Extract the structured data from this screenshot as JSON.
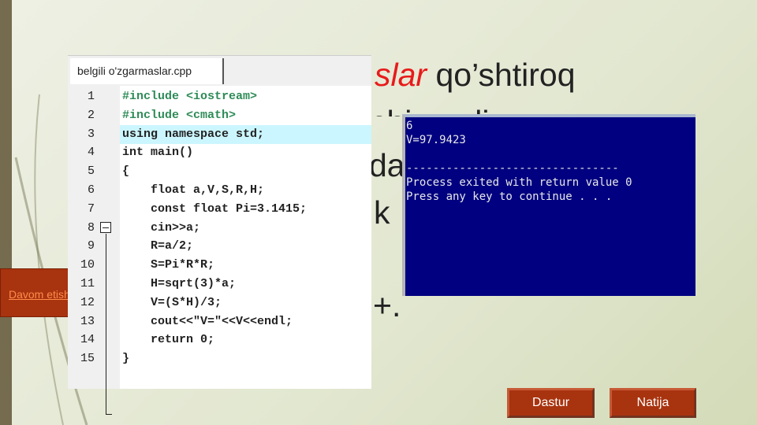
{
  "slide": {
    "fragments": [
      "slar",
      "qo’shtiroq",
      "chiga olingan",
      "da",
      "’ k",
      "+",
      "."
    ]
  },
  "editor": {
    "tab": "belgili o'zgarmaslar.cpp",
    "line_numbers": [
      "1",
      "2",
      "3",
      "4",
      "5",
      "6",
      "7",
      "8",
      "9",
      "10",
      "11",
      "12",
      "13",
      "14",
      "15"
    ],
    "lines": [
      "#include <iostream>",
      "#include <cmath>",
      "using namespace std;",
      "int main()",
      "{",
      "    float a,V,S,R,H;",
      "    const float Pi=3.1415;",
      "    cin>>a;",
      "    R=a/2;",
      "    S=Pi*R*R;",
      "    H=sqrt(3)*a;",
      "    V=(S*H)/3;",
      "    cout<<\"V=\"<<V<<endl;",
      "    return 0;",
      "}"
    ]
  },
  "console": {
    "text": "6\nV=97.9423\n\n--------------------------------\nProcess exited with return value 0\nPress any key to continue . . ."
  },
  "buttons": {
    "davom": "Davom etish",
    "dastur": "Dastur",
    "natija": "Natija"
  },
  "colors": {
    "button": "#a8330f",
    "console_bg": "#000080",
    "accent_red": "#e81a1a"
  }
}
